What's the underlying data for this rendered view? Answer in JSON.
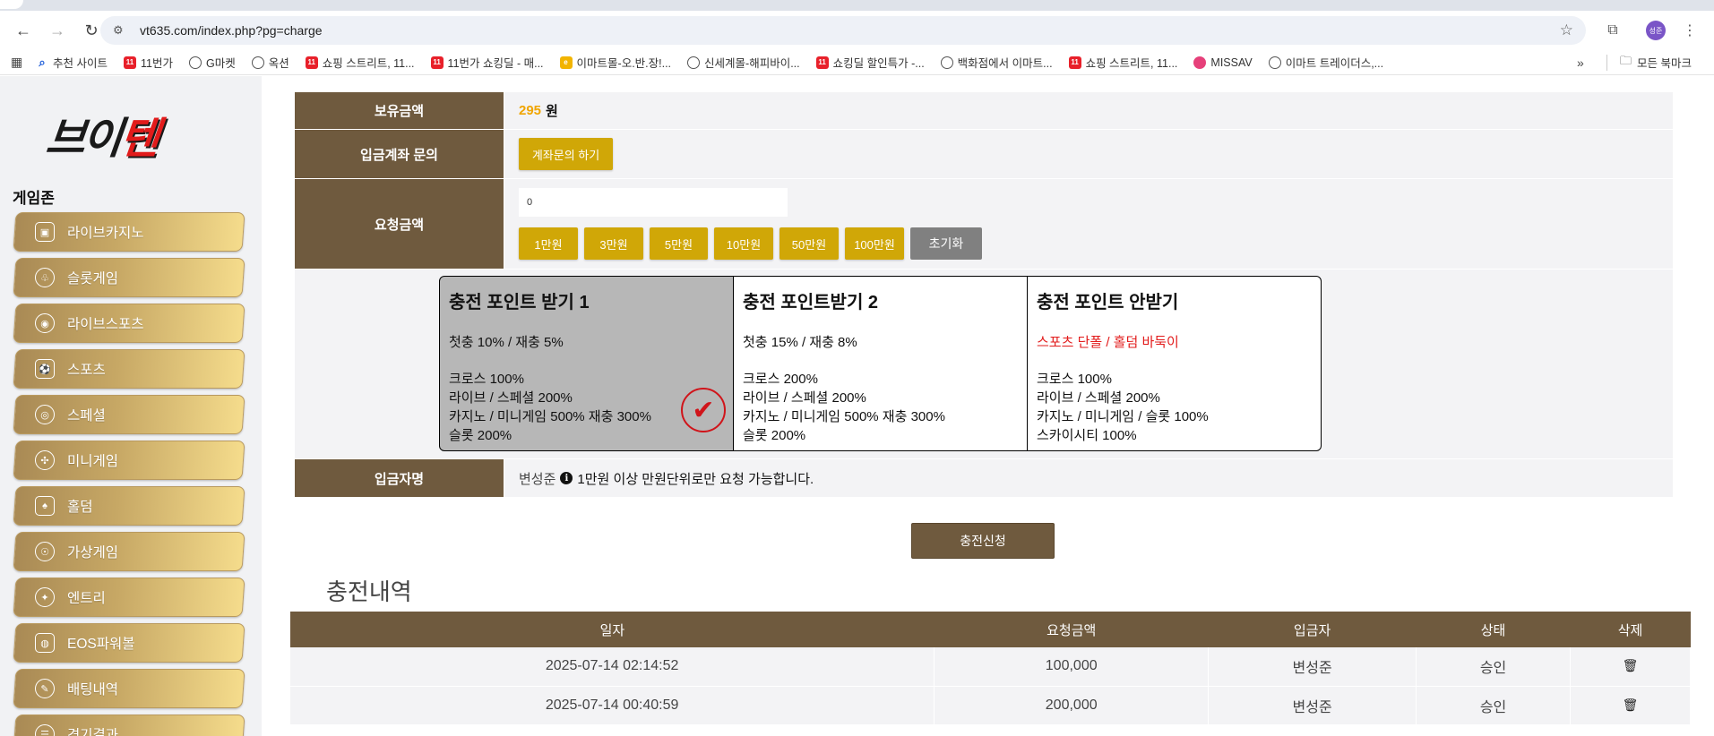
{
  "browser": {
    "url": "vt635.com/index.php?pg=charge",
    "profile_initials": "성준",
    "bookmarks": [
      {
        "label": "추천 사이트",
        "icon": "search"
      },
      {
        "label": "11번가",
        "icon": "red"
      },
      {
        "label": "G마켓",
        "icon": "globe"
      },
      {
        "label": "옥션",
        "icon": "globe"
      },
      {
        "label": "쇼핑 스트리트, 11...",
        "icon": "red"
      },
      {
        "label": "11번가 쇼킹딜 - 매...",
        "icon": "red"
      },
      {
        "label": "이마트몰-오.반.장!...",
        "icon": "yellow"
      },
      {
        "label": "신세계몰-해피바이...",
        "icon": "globe"
      },
      {
        "label": "쇼킹딜 할인특가 -...",
        "icon": "red"
      },
      {
        "label": "백화점에서 이마트...",
        "icon": "globe"
      },
      {
        "label": "쇼핑 스트리트, 11...",
        "icon": "red"
      },
      {
        "label": "MISSAV",
        "icon": "pink"
      },
      {
        "label": "이마트 트레이더스,...",
        "icon": "globe"
      }
    ],
    "all_bookmarks": "모든 북마크"
  },
  "sidebar": {
    "logo_part1": "브이",
    "logo_part2": "텐",
    "section_title": "게임존",
    "items": [
      {
        "label": "라이브카지노",
        "icon": "▣"
      },
      {
        "label": "슬롯게임",
        "icon": "♧"
      },
      {
        "label": "라이브스포츠",
        "icon": "◉"
      },
      {
        "label": "스포츠",
        "icon": "⚽"
      },
      {
        "label": "스페셜",
        "icon": "◎"
      },
      {
        "label": "미니게임",
        "icon": "✣"
      },
      {
        "label": "홀덤",
        "icon": "♠"
      },
      {
        "label": "가상게임",
        "icon": "☉"
      },
      {
        "label": "엔트리",
        "icon": "✦"
      },
      {
        "label": "EOS파워볼",
        "icon": "◍"
      },
      {
        "label": "배팅내역",
        "icon": "✎"
      },
      {
        "label": "경기결과",
        "icon": "☰"
      }
    ]
  },
  "form": {
    "balance_label": "보유금액",
    "balance_value": "295",
    "balance_unit": "원",
    "account_label": "입금계좌 문의",
    "account_button": "계좌문의 하기",
    "request_label": "요청금액",
    "request_value": "0",
    "amount_buttons": [
      "1만원",
      "3만원",
      "5만원",
      "10만원",
      "50만원",
      "100만원"
    ],
    "reset_button": "초기화",
    "depositor_label": "입금자명",
    "depositor_name": "변성준",
    "notice": "1만원 이상 만원단위로만 요청 가능합니다.",
    "submit_button": "충전신청"
  },
  "point_options": [
    {
      "title": "충전 포인트 받기 1",
      "line1": "첫충 10% / 재충 5%",
      "details": [
        "크로스 100%",
        "라이브 / 스페셜 200%",
        "카지노 / 미니게임 500% 재충 300%",
        "슬롯 200%"
      ],
      "selected": true
    },
    {
      "title": "충전 포인트받기 2",
      "line1": "첫충 15% / 재충 8%",
      "details": [
        "크로스 200%",
        "라이브 / 스페셜 200%",
        "카지노 / 미니게임 500% 재충 300%",
        "슬롯 200%"
      ],
      "selected": false
    },
    {
      "title": "충전 포인트 안받기",
      "line1": "스포츠 단폴 / 홀덤 바둑이",
      "details": [
        "크로스 100%",
        "라이브 / 스페셜 200%",
        "카지노 / 미니게임 / 슬롯 100%",
        "스카이시티 100%"
      ],
      "selected": false
    }
  ],
  "history": {
    "title": "충전내역",
    "columns": [
      "일자",
      "요청금액",
      "입금자",
      "상태",
      "삭제"
    ],
    "rows": [
      {
        "date": "2025-07-14 02:14:52",
        "amount": "100,000",
        "depositor": "변성준",
        "status": "승인"
      },
      {
        "date": "2025-07-14 00:40:59",
        "amount": "200,000",
        "depositor": "변성준",
        "status": "승인"
      }
    ]
  }
}
